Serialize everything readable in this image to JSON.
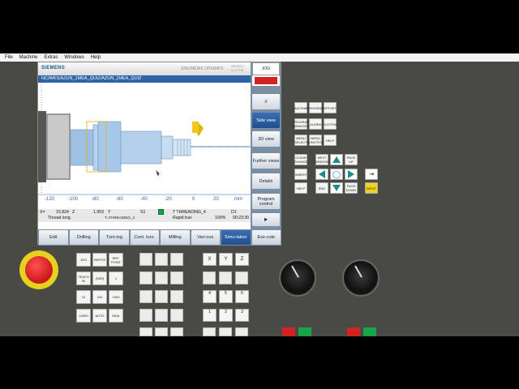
{
  "menubar": [
    "File",
    "Machine",
    "Extras",
    "Windows",
    "Help"
  ],
  "header": {
    "brand": "SIEMENS",
    "product": "SINUMERIK OPERATE",
    "date": "05/06/23",
    "time": "6:19 PM"
  },
  "program_path": "NC/WKS/AZUN_1MEA_QUIZ/AZUN_1MEA_QUIZ",
  "mode_buttons": {
    "jog": "JOG"
  },
  "vertical_softkeys": {
    "v1": "//",
    "v2": "Side view",
    "v3": "3D view",
    "v4": "Further views",
    "v5": "Details",
    "v6": "Program control"
  },
  "horizontal_softkeys": [
    {
      "label": "Edit",
      "active": false
    },
    {
      "label": "Drilling",
      "active": false
    },
    {
      "label": "Turn-ing",
      "active": false
    },
    {
      "label": "Cont. turn.",
      "active": false
    },
    {
      "label": "Milling",
      "active": false
    },
    {
      "label": "Vari-ous",
      "active": false
    },
    {
      "label": "Simu-lation",
      "active": true
    },
    {
      "label": "Exe-cute",
      "active": false
    }
  ],
  "axis_ticks": [
    "-120",
    "-100",
    "-80",
    "-60",
    "-40",
    "-20",
    "0",
    "20"
  ],
  "axis_unit": "mm",
  "status": {
    "x_label": "X=",
    "x_value": "15.824",
    "z_label": "Z",
    "z_value": "1.953",
    "y_label": "Y",
    "s_label": "S1",
    "tool": "T THREADING_4",
    "d": "D1",
    "block": "Thread long.",
    "tool_short": "T=THREADING_4",
    "feed_mode": "Rapid trav",
    "override": "100%",
    "time": "00:23:30"
  },
  "panel_keys": {
    "r1": [
      "MACHINE",
      "PROGRAM",
      "OFFSET"
    ],
    "r2": [
      "PROGRAM MANAGER",
      "ALARM",
      "CUSTOM"
    ],
    "r3": [
      "MENU SELECT",
      "MENU FUNCTION",
      "HELP"
    ],
    "nav": [
      "CLEAR CHANGE",
      "NEXT WINDOW",
      "PAGE UP",
      "INSERT",
      "SELECT",
      "PAGE DOWN",
      "END",
      "INPUT"
    ],
    "help": "HELP",
    "end": "END"
  },
  "letters": [
    "X",
    "Y",
    "Z"
  ],
  "numbers": [
    "4",
    "5",
    "6",
    "1",
    "2",
    "3"
  ],
  "machine_keys": [
    "JOG",
    "REPOS",
    "REF. POINT",
    "TEACH IN",
    "[VAR]",
    "1",
    "10",
    "100",
    "1000",
    "10000",
    "AUTO",
    "MDA"
  ],
  "colors": {
    "accent": "#2d63a8",
    "sim_part": "#8fb3d9",
    "tool": "#e2b300",
    "stop": "#d22222"
  }
}
